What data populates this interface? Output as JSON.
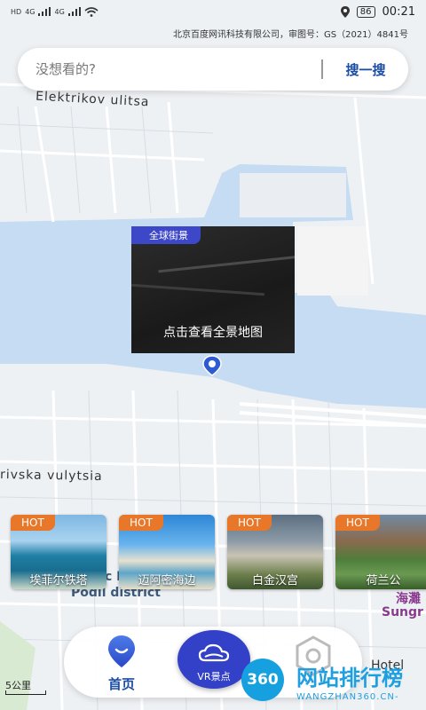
{
  "status_bar": {
    "left_icons": [
      "HD",
      "4G",
      "signal",
      "4G",
      "signal",
      "wifi"
    ],
    "battery": "86",
    "time": "00:21"
  },
  "map": {
    "credit": "北京百度网讯科技有限公司，审图号：GS（2021）4841号",
    "street_labels": [
      "Elektrikov ulitsa",
      "rivska vulytsia"
    ],
    "district_label": "Podil district",
    "district_partial": "c N",
    "right_labels": [
      "海灘",
      "Sungr"
    ],
    "hotel_label": "Hotel",
    "scale": "5公里"
  },
  "search": {
    "placeholder": "没想看的?",
    "button": "搜一搜"
  },
  "panorama": {
    "badge": "全球街景",
    "caption": "点击查看全景地图"
  },
  "hot_spots": [
    {
      "badge": "HOT",
      "label": "埃菲尔铁塔"
    },
    {
      "badge": "HOT",
      "label": "迈阿密海边"
    },
    {
      "badge": "HOT",
      "label": "白金汉宫"
    },
    {
      "badge": "HOT",
      "label": "荷兰公"
    }
  ],
  "nav": {
    "home": "首页",
    "vr": "VR景点"
  },
  "watermark": {
    "logo": "360",
    "title": "网站排行榜",
    "subtitle": "WANGZHAN360.CN-"
  },
  "colors": {
    "accent_blue": "#1d4ea6",
    "nav_vr": "#3340c8",
    "hot_badge": "#e8772a",
    "water": "#c6dcf3"
  }
}
